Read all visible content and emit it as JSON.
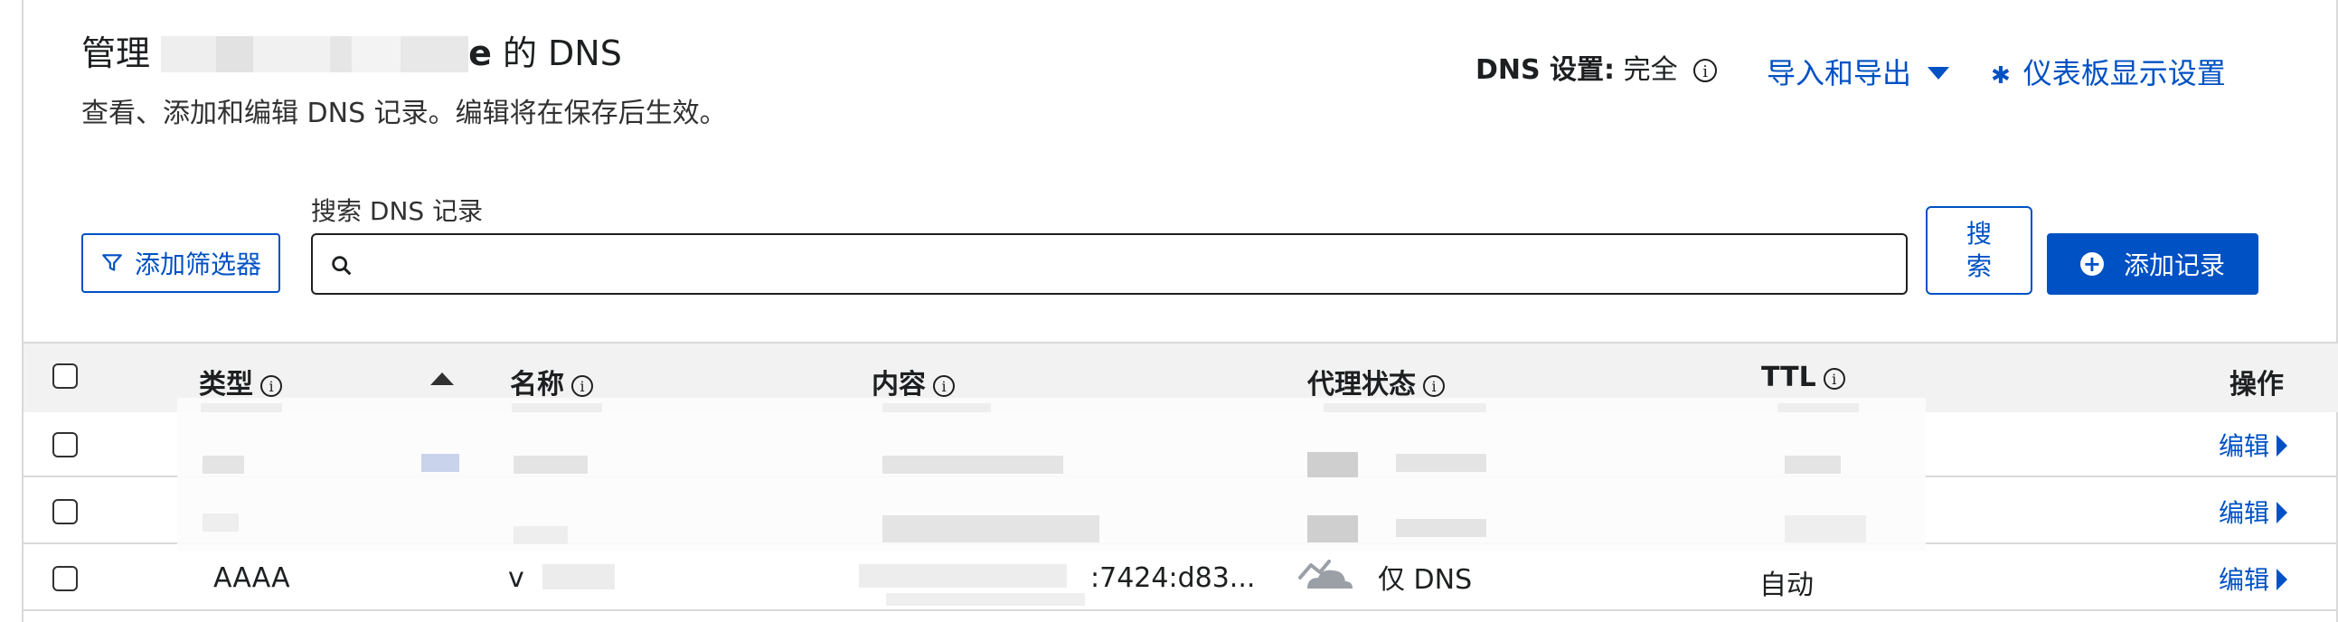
{
  "header": {
    "title_prefix": "管理",
    "title_suffix_bold": "e",
    "title_suffix": " 的 DNS",
    "subtitle": "查看、添加和编辑 DNS 记录。编辑将在保存后生效。",
    "dns_setting_label": "DNS 设置:",
    "dns_setting_value": "完全",
    "import_export": "导入和导出",
    "dashboard_settings": "仪表板显示设置"
  },
  "toolbar": {
    "filter_button": "添加筛选器",
    "search_label": "搜索 DNS 记录",
    "search_placeholder": "",
    "search_button_line1": "搜",
    "search_button_line2": "索",
    "add_record_button": "添加记录"
  },
  "table": {
    "columns": [
      "类型",
      "名称",
      "内容",
      "代理状态",
      "TTL",
      "操作"
    ],
    "rows": [
      {
        "type": "",
        "name": "",
        "content": "",
        "proxy": "",
        "ttl": "",
        "action": "编辑"
      },
      {
        "type": "",
        "name": "",
        "content": "",
        "proxy": "",
        "ttl": "",
        "action": "编辑"
      },
      {
        "type": "AAAA",
        "name": "v",
        "content": ":7424:d83...",
        "proxy": "仅 DNS",
        "ttl": "自动",
        "action": "编辑"
      }
    ]
  },
  "icons": {
    "info": "info-icon",
    "filter": "filter-icon",
    "search": "search-icon",
    "gear": "gear-icon",
    "plus": "plus-circle-icon",
    "cloud": "cloud-dns-only-icon"
  },
  "colors": {
    "accent": "#0051c3",
    "header_bg": "#f2f2f2",
    "border": "#d9d9d9"
  }
}
